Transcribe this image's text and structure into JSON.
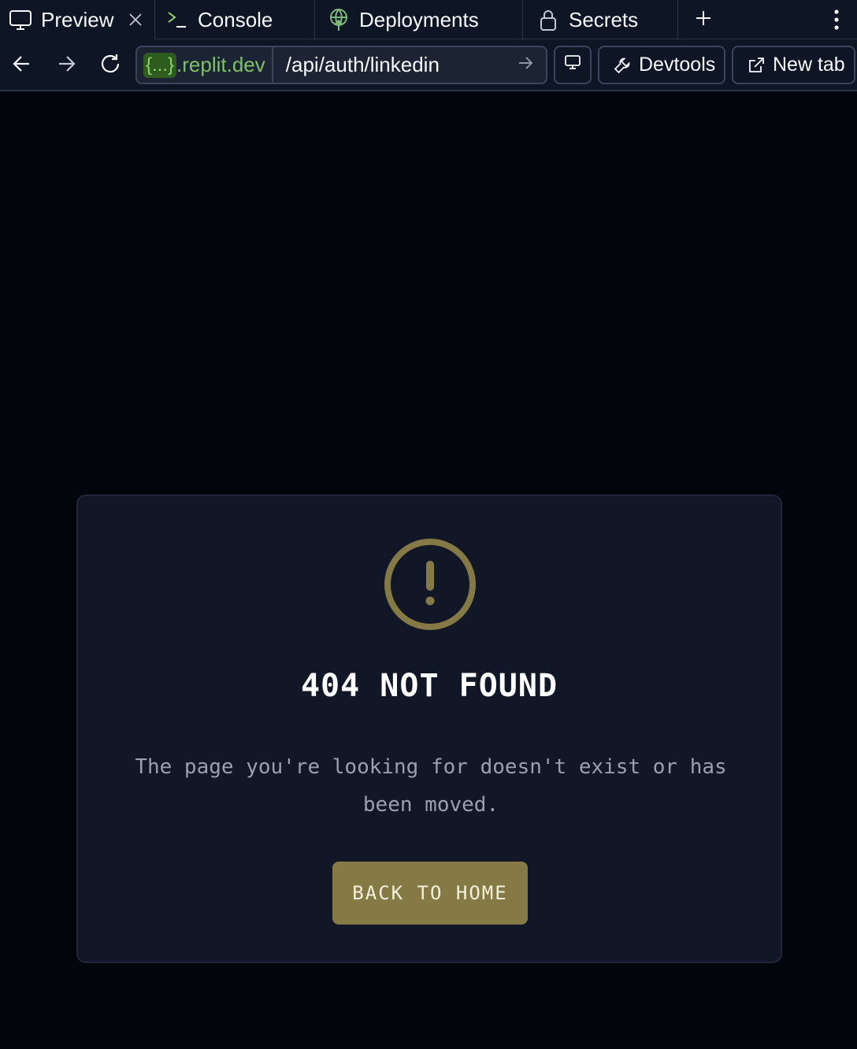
{
  "tabs": {
    "preview": "Preview",
    "console": "Console",
    "deployments": "Deployments",
    "secrets": "Secrets"
  },
  "address_bar": {
    "host_chip": "{...}",
    "host_suffix": ".replit.dev",
    "path": "/api/auth/linkedin"
  },
  "toolbar": {
    "devtools_label": "Devtools",
    "newtab_label": "New tab"
  },
  "page": {
    "title": "404 NOT FOUND",
    "description": "The page you're looking for doesn't exist or has been moved.",
    "button_label": "BACK TO HOME"
  },
  "colors": {
    "accent": "#857a45",
    "card": "#111726",
    "background": "#03050c",
    "host_green": "#7fc16b"
  },
  "icons": [
    "monitor-icon",
    "close-icon",
    "terminal-icon",
    "deployments-icon",
    "lock-icon",
    "plus-icon",
    "more-vertical-icon",
    "arrow-left-icon",
    "arrow-right-icon",
    "reload-icon",
    "wrench-icon",
    "external-link-icon",
    "warning-circle-icon"
  ]
}
